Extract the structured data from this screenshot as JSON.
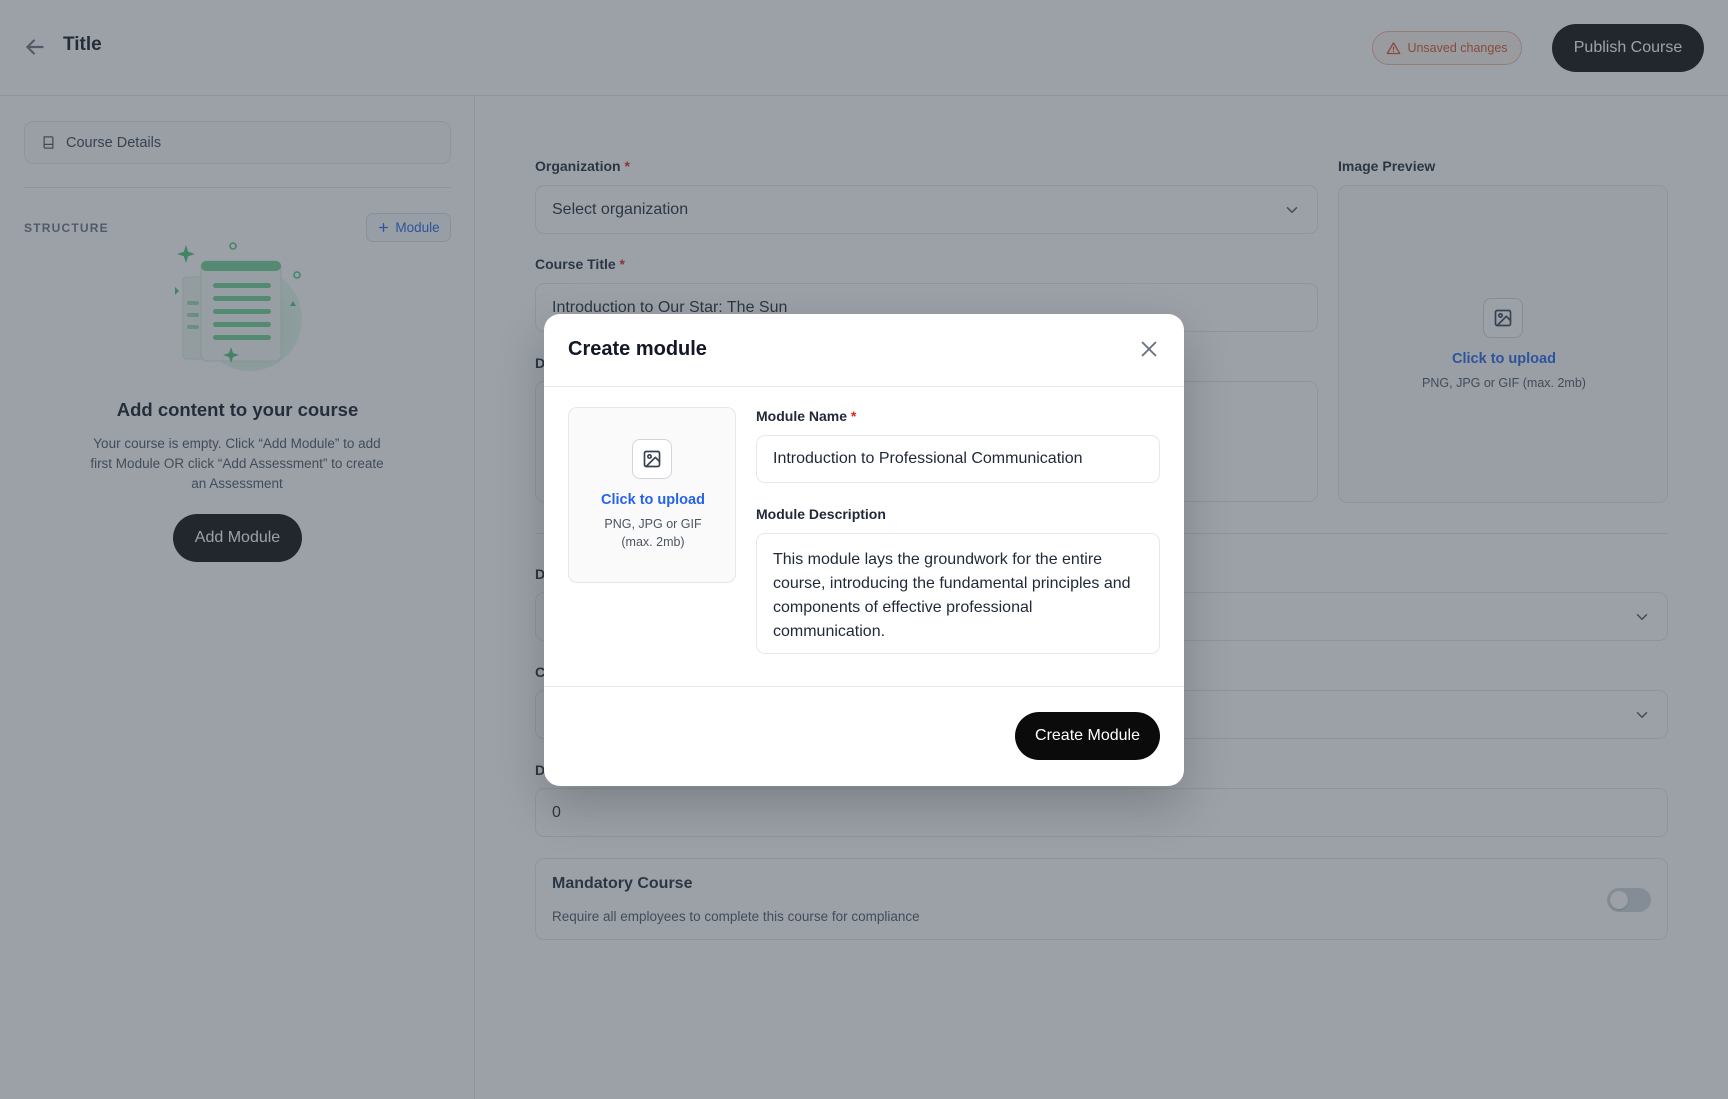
{
  "header": {
    "title": "Title",
    "unsaved_label": "Unsaved changes",
    "publish_label": "Publish Course"
  },
  "sidebar": {
    "course_details_label": "Course Details",
    "structure_label": "STRUCTURE",
    "add_module_chip_label": "Module",
    "empty_title": "Add content to your course",
    "empty_description": "Your course is empty. Click “Add Module” to add first Module OR click “Add Assessment” to create an Assessment",
    "add_module_button": "Add Module"
  },
  "form": {
    "organization_label": "Organization",
    "organization_value": "Select organization",
    "course_title_label": "Course Title",
    "course_title_value": "Introduction to Our Star: The Sun",
    "partial_label_1": "D",
    "partial_label_2": "D",
    "partial_label_3": "C",
    "partial_label_4": "D",
    "duration_value": "0",
    "image_preview_label": "Image Preview",
    "upload_link": "Click to upload",
    "upload_hint": "PNG, JPG or GIF (max. 2mb)",
    "mandatory_title": "Mandatory Course",
    "mandatory_description": "Require all employees to complete this course for compliance",
    "required_marker": "*"
  },
  "modal": {
    "title": "Create module",
    "upload_link": "Click to upload",
    "upload_hint_line1": "PNG, JPG or GIF",
    "upload_hint_line2": "(max. 2mb)",
    "module_name_label": "Module Name",
    "module_name_value": "Introduction to Professional Communication",
    "module_description_label": "Module Description",
    "module_description_value": "This module lays the groundwork for the entire course, introducing the fundamental principles and components of effective professional communication.",
    "create_button": "Create Module"
  },
  "colors": {
    "accent_link": "#2563eb",
    "primary_button": "#0b0b0b",
    "warning": "#d1542a",
    "required": "#dc2626",
    "illustration_green": "#4cc47a"
  },
  "toggles": {
    "mandatory_course": false
  }
}
